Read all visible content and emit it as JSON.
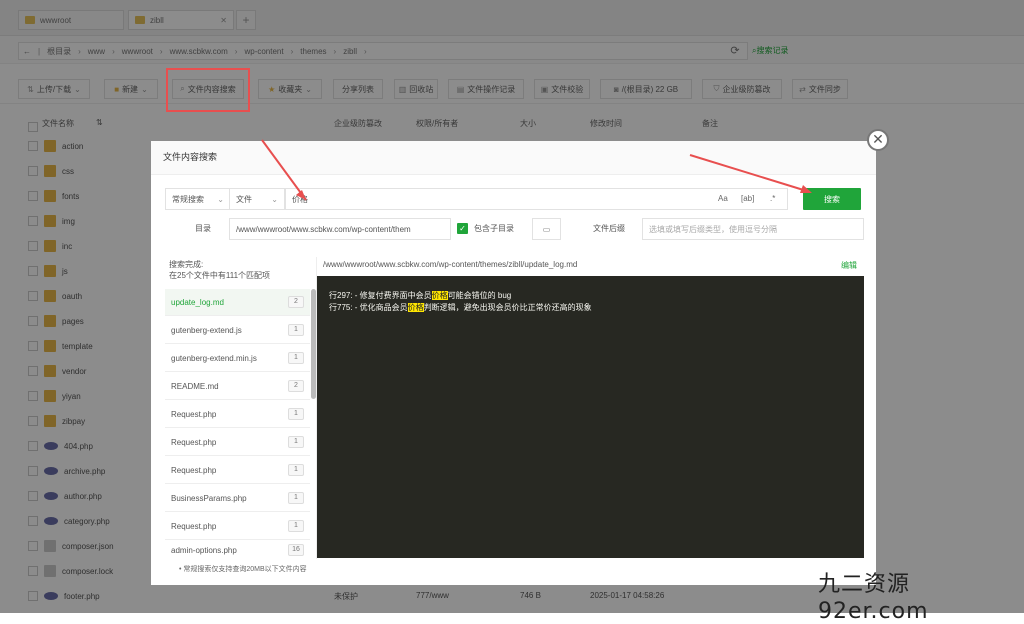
{
  "tabs": [
    {
      "label": "wwwroot"
    },
    {
      "label": "zibll"
    }
  ],
  "address": {
    "crumbs": [
      "根目录",
      "www",
      "wwwroot",
      "www.scbkw.com",
      "wp-content",
      "themes",
      "zibll"
    ],
    "history_label": "搜索记录"
  },
  "toolbar": {
    "upload": "上传/下载",
    "new": "新建",
    "content_search": "文件内容搜索",
    "favorites": "收藏夹",
    "share_list": "分享列表",
    "trash": "回收站",
    "op_log": "文件操作记录",
    "file_verify": "文件校验",
    "disk": "/(根目录) 22 GB",
    "tamper": "企业级防篡改",
    "sync": "文件同步"
  },
  "columns": {
    "name": "文件名称",
    "tamper": "企业级防篡改",
    "perm": "权限/所有者",
    "size": "大小",
    "mtime": "修改时间",
    "remark": "备注"
  },
  "files": [
    {
      "name": "action",
      "type": "folder"
    },
    {
      "name": "css",
      "type": "folder"
    },
    {
      "name": "fonts",
      "type": "folder"
    },
    {
      "name": "img",
      "type": "folder"
    },
    {
      "name": "inc",
      "type": "folder"
    },
    {
      "name": "js",
      "type": "folder"
    },
    {
      "name": "oauth",
      "type": "folder"
    },
    {
      "name": "pages",
      "type": "folder"
    },
    {
      "name": "template",
      "type": "folder"
    },
    {
      "name": "vendor",
      "type": "folder"
    },
    {
      "name": "yiyan",
      "type": "folder"
    },
    {
      "name": "zibpay",
      "type": "folder"
    },
    {
      "name": "404.php",
      "type": "php"
    },
    {
      "name": "archive.php",
      "type": "php"
    },
    {
      "name": "author.php",
      "type": "php"
    },
    {
      "name": "category.php",
      "type": "php"
    },
    {
      "name": "composer.json",
      "type": "doc"
    },
    {
      "name": "composer.lock",
      "type": "doc"
    },
    {
      "name": "footer.php",
      "type": "php"
    }
  ],
  "bottom_row": {
    "protect": "未保护",
    "perm": "777/www",
    "size": "746 B",
    "mtime": "2025-01-17 04:58:26"
  },
  "modal": {
    "title": "文件内容搜索",
    "mode": "常规搜索",
    "scope": "文件",
    "query": "价格",
    "options": [
      "Aa",
      "[ab]",
      ".*"
    ],
    "search_button": "搜索",
    "dir_label": "目录",
    "dir_value": "/www/wwwroot/www.scbkw.com/wp-content/them",
    "include_sub": "包含子目录",
    "ext_label": "文件后缀",
    "ext_placeholder": "选填或填写后缀类型，使用逗号分隔",
    "result_status": "搜索完成:",
    "result_summary": "在25个文件中有111个匹配项",
    "results": [
      {
        "name": "update_log.md",
        "count": "2"
      },
      {
        "name": "gutenberg-extend.js",
        "count": "1"
      },
      {
        "name": "gutenberg-extend.min.js",
        "count": "1"
      },
      {
        "name": "README.md",
        "count": "2"
      },
      {
        "name": "Request.php",
        "count": "1"
      },
      {
        "name": "Request.php",
        "count": "1"
      },
      {
        "name": "Request.php",
        "count": "1"
      },
      {
        "name": "BusinessParams.php",
        "count": "1"
      },
      {
        "name": "Request.php",
        "count": "1"
      },
      {
        "name": "admin-options.php",
        "count": "16"
      }
    ],
    "file_path": "/www/wwwroot/www.scbkw.com/wp-content/themes/zibll/update_log.md",
    "edit_label": "编辑",
    "lines": [
      {
        "prefix": "行297: - 修复付费界面中会员",
        "match": "价格",
        "suffix": "可能会错位的 bug"
      },
      {
        "prefix": "行775: - 优化商品会员",
        "match": "价格",
        "suffix": "判断逻辑，避免出现会员价比正常价还高的现象"
      }
    ],
    "note": "• 常规搜索仅支持查询20MB以下文件内容"
  },
  "watermark": {
    "cn": "九二资源",
    "en": "92er.com"
  }
}
